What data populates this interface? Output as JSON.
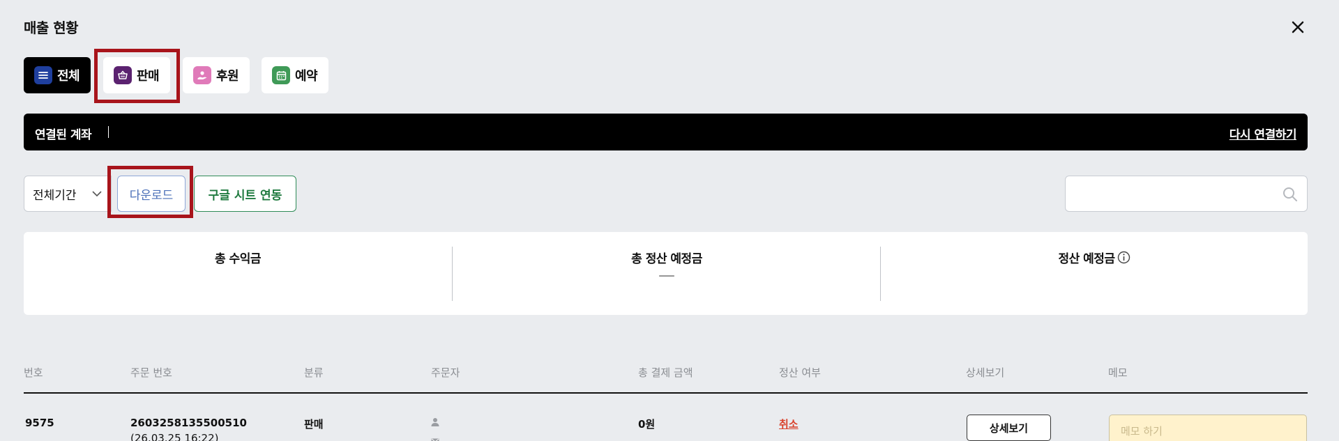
{
  "header": {
    "title": "매출 현황",
    "close_icon": "close-icon"
  },
  "tabs": [
    {
      "label": "전체",
      "icon": "list-icon",
      "icon_bg": "#1f3f9e",
      "active": true
    },
    {
      "label": "판매",
      "icon": "basket-icon",
      "icon_bg": "#5b2270",
      "active": false
    },
    {
      "label": "후원",
      "icon": "donate-hand-icon",
      "icon_bg": "#e07ab9",
      "active": false
    },
    {
      "label": "예약",
      "icon": "calendar-icon",
      "icon_bg": "#3f9a57",
      "active": false
    }
  ],
  "account": {
    "label": "연결된 계좌",
    "reconnect_label": "다시 연결하기"
  },
  "toolbar": {
    "period_value": "전체기간",
    "download_label": "다운로드",
    "sheet_label": "구글 시트 연동",
    "search_placeholder": ""
  },
  "summary": {
    "total_revenue_label": "총 수익금",
    "total_revenue_value": "",
    "total_settlement_label": "총 정산 예정금",
    "total_settlement_value": "—",
    "settlement_label": "정산 예정금",
    "settlement_value": ""
  },
  "table": {
    "columns": [
      "번호",
      "주문 번호",
      "분류",
      "주문자",
      "총 결제 금액",
      "정산 여부",
      "상세보기",
      "메모"
    ],
    "rows": [
      {
        "no": "9575",
        "order_no": "2603258135500510",
        "order_date": "(26.03.25 16:22)",
        "category": "판매",
        "total": "0원",
        "status": "취소",
        "detail_label": "상세보기",
        "memo_placeholder": "메모 하기"
      }
    ]
  },
  "colors": {
    "highlight": "#a8141b",
    "cancel": "#d9422c",
    "memo_bg": "#fff2cc"
  }
}
